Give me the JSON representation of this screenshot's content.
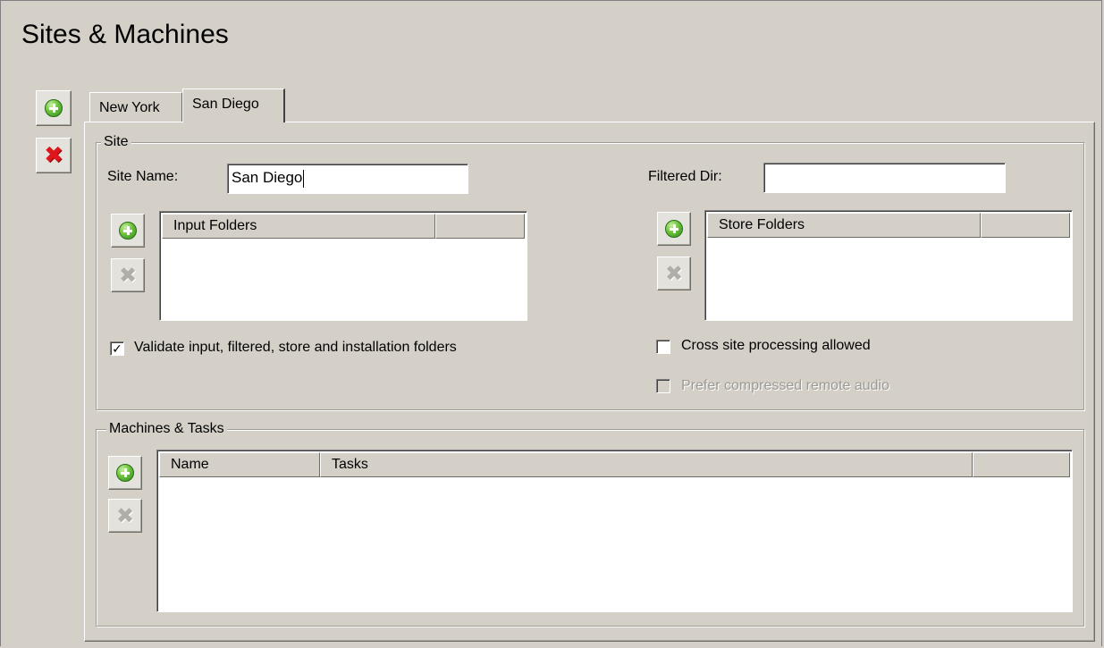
{
  "page": {
    "title": "Sites & Machines"
  },
  "side_buttons": {
    "add_icon": "add-circle-icon",
    "delete_icon": "red-x-icon"
  },
  "tabs": [
    {
      "label": "New York",
      "selected": false
    },
    {
      "label": "San Diego",
      "selected": true
    }
  ],
  "site": {
    "group_title": "Site",
    "site_name_label": "Site Name:",
    "site_name_value": "San Diego",
    "filtered_dir_label": "Filtered Dir:",
    "filtered_dir_value": "",
    "input_folders": {
      "columns": [
        "Input Folders",
        ""
      ],
      "rows": []
    },
    "store_folders": {
      "columns": [
        "Store Folders",
        ""
      ],
      "rows": []
    },
    "validate_label": "Validate input, filtered, store and installation folders",
    "validate_checked": true,
    "cross_site_label": "Cross site processing allowed",
    "cross_site_checked": false,
    "prefer_compressed_label": "Prefer compressed remote audio",
    "prefer_compressed_checked": false,
    "prefer_compressed_enabled": false
  },
  "machines": {
    "group_title": "Machines & Tasks",
    "columns": [
      "Name",
      "Tasks",
      ""
    ],
    "rows": []
  },
  "colors": {
    "background": "#d4d0c8",
    "add_green": "#6cc23c",
    "delete_red": "#e0141b"
  }
}
